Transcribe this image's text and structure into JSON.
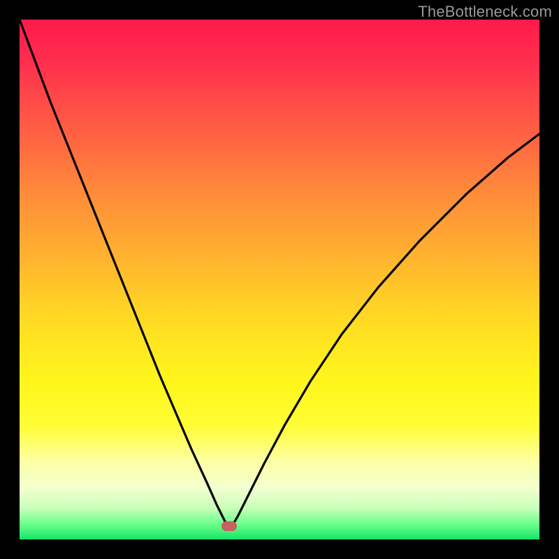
{
  "watermark": {
    "text": "TheBottleneck.com"
  },
  "colors": {
    "frame": "#000000",
    "curve": "#000000",
    "marker": "#c86060",
    "gradient_top": "#ff1a4a",
    "gradient_bottom": "#18e468"
  },
  "chart_data": {
    "type": "line",
    "title": "",
    "xlabel": "",
    "ylabel": "",
    "xlim": [
      0,
      100
    ],
    "ylim": [
      0,
      100
    ],
    "grid": false,
    "legend": null,
    "marker": {
      "x": 40.3,
      "y": 2.5
    },
    "series": [
      {
        "name": "bottleneck-curve",
        "x": [
          0,
          3,
          6,
          9,
          12,
          15,
          18,
          21,
          24,
          27,
          30,
          33,
          36,
          38,
          39.5,
          40.3,
          41,
          42,
          44,
          47,
          51,
          56,
          62,
          69,
          77,
          86,
          94,
          100
        ],
        "y": [
          100,
          92,
          84,
          76.5,
          69,
          61.5,
          54,
          46.5,
          39,
          31.5,
          24.5,
          17.5,
          11,
          6.5,
          3.5,
          2.5,
          2.8,
          4.5,
          8.5,
          14.5,
          22,
          30.5,
          39.5,
          48.5,
          57.5,
          66.5,
          73.5,
          78
        ]
      }
    ]
  }
}
